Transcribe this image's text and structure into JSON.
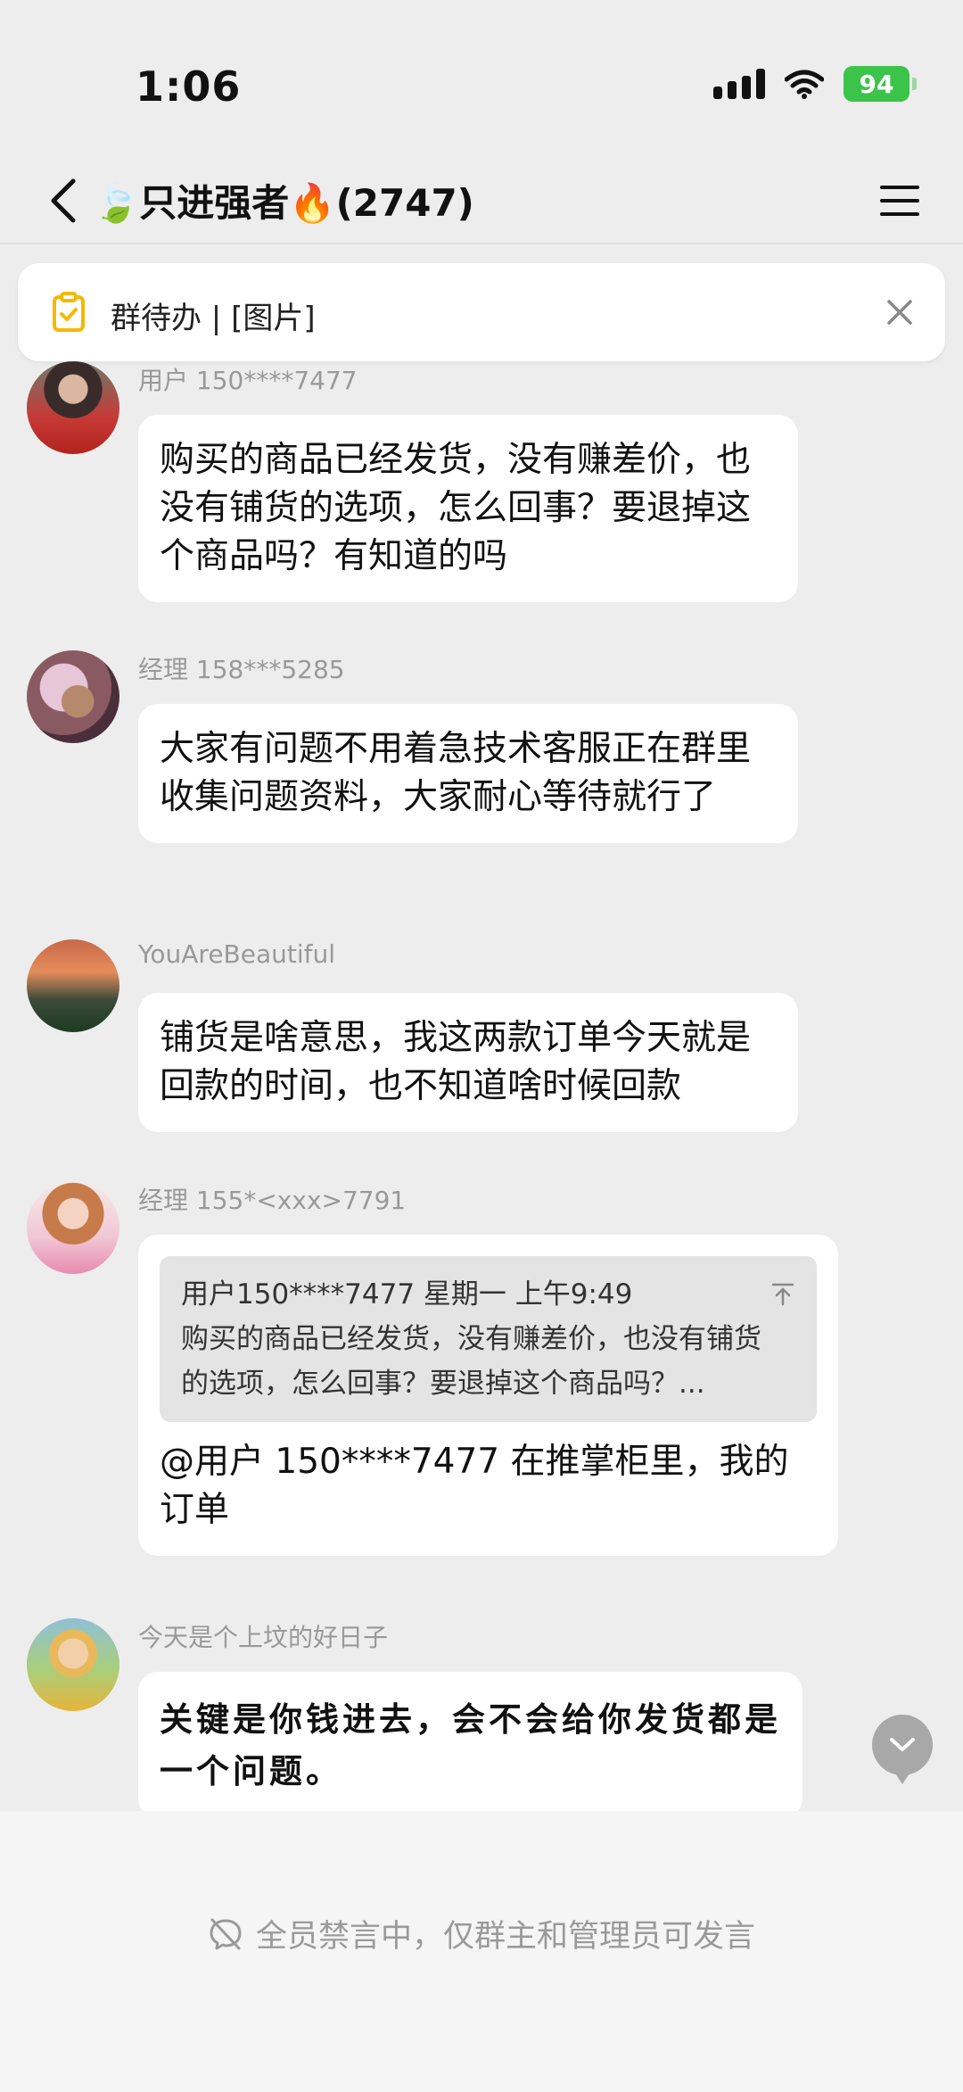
{
  "status_bar": {
    "time": "1:06",
    "battery": "94"
  },
  "header": {
    "title": "🍃只进强者🔥(2747)"
  },
  "todo_bar": {
    "label": "群待办 | [图片]"
  },
  "messages": [
    {
      "sender": "用户 150****7477",
      "text": "购买的商品已经发货，没有赚差价，也没有铺货的选项，怎么回事？要退掉这个商品吗？有知道的吗"
    },
    {
      "sender": "经理 158***5285",
      "text": "大家有问题不用着急技术客服正在群里收集问题资料，大家耐心等待就行了"
    },
    {
      "sender": "YouAreBeautiful",
      "text": "铺货是啥意思，我这两款订单今天就是回款的时间，也不知道啥时候回款"
    },
    {
      "sender": "经理 155*<xxx>7791",
      "quote": {
        "header": "用户150****7477 星期一 上午9:49",
        "text": "购买的商品已经发货，没有赚差价，也没有铺货的选项，怎么回事？要退掉这个商品吗？..."
      },
      "text": "@用户 150****7477 在推掌柜里，我的订单"
    },
    {
      "sender": "今天是个上坟的好日子",
      "text": "关键是你钱进去，会不会给你发货都是一个问题。"
    }
  ],
  "footer": {
    "notice": "全员禁言中，仅群主和管理员可发言"
  }
}
